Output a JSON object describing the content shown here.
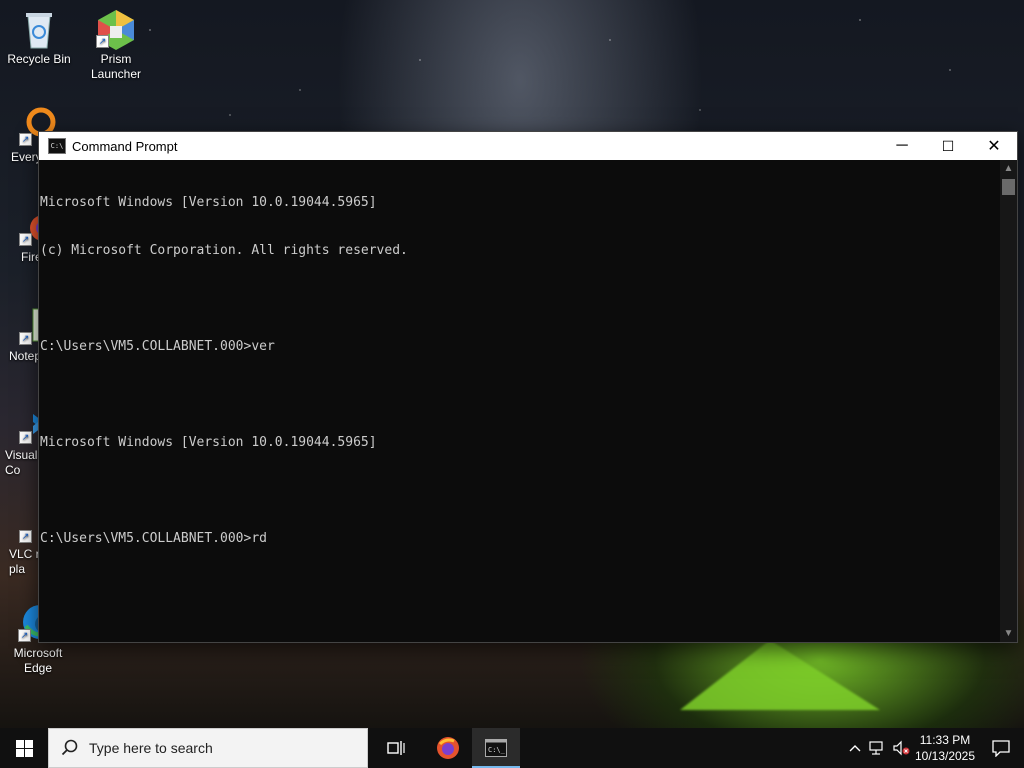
{
  "desktop": {
    "icons": [
      {
        "name": "recycle-bin",
        "label": "Recycle Bin"
      },
      {
        "name": "prism-launcher",
        "label": "Prism\nLauncher"
      },
      {
        "name": "everything",
        "label": "Every"
      },
      {
        "name": "firefox",
        "label": "Fire"
      },
      {
        "name": "notepad",
        "label": "Notep"
      },
      {
        "name": "visual-studio-code",
        "label": "Visual\nCo"
      },
      {
        "name": "vlc",
        "label": "VLC r\npla"
      },
      {
        "name": "microsoft-edge",
        "label": "Microsoft\nEdge"
      }
    ]
  },
  "window": {
    "title": "Command Prompt",
    "icon": "cmd-icon",
    "console_lines": [
      "Microsoft Windows [Version 10.0.19044.5965]",
      "(c) Microsoft Corporation. All rights reserved.",
      "",
      "C:\\Users\\VM5.COLLABNET.000>ver",
      "",
      "Microsoft Windows [Version 10.0.19044.5965]",
      "",
      "C:\\Users\\VM5.COLLABNET.000>rd"
    ],
    "controls": {
      "minimize": "─",
      "maximize": "☐",
      "close": "✕"
    }
  },
  "taskbar": {
    "search_placeholder": "Type here to search",
    "time": "11:33 PM",
    "date": "10/13/2025",
    "colors": {
      "taskbar": "#101010",
      "active_indicator": "#76b9ed"
    }
  }
}
